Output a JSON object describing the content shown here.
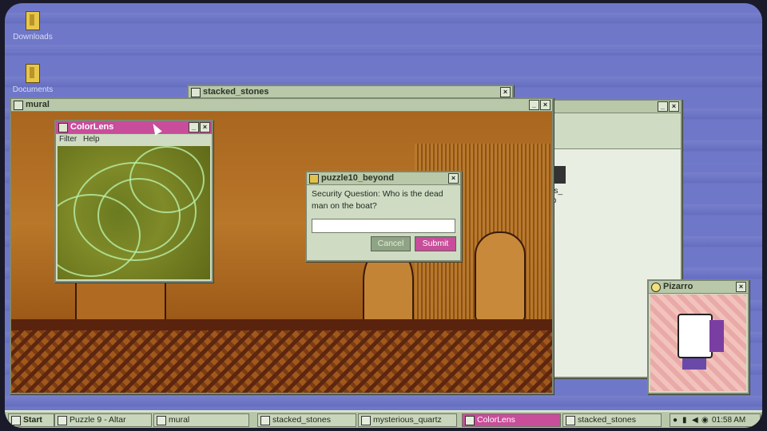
{
  "desktop": {
    "icons": [
      {
        "label": "Downloads",
        "icon": "folder-icon"
      },
      {
        "label": "Documents",
        "icon": "folder-icon"
      }
    ]
  },
  "windows": {
    "stacked_stones": {
      "title": "stacked_stones"
    },
    "back_window": {
      "partial_text": [
        "us_",
        "tp"
      ]
    },
    "mural": {
      "title": "mural"
    },
    "colorlens": {
      "title": "ColorLens",
      "menu": [
        "Filter",
        "Help"
      ]
    },
    "dialog": {
      "title": "puzzle10_beyond",
      "question": "Security Question: Who is the dead man on the boat?",
      "input_value": "",
      "cancel_label": "Cancel",
      "submit_label": "Submit"
    },
    "pizarro": {
      "title": "Pizarro"
    }
  },
  "taskbar": {
    "start_label": "Start",
    "items": [
      {
        "label": "Puzzle 9 - Altar",
        "active": false
      },
      {
        "label": "mural",
        "active": false
      },
      {
        "label": "stacked_stones",
        "active": false
      },
      {
        "label": "mysterious_quartz",
        "active": false
      },
      {
        "label": "ColorLens",
        "active": true
      },
      {
        "label": "stacked_stones",
        "active": false
      }
    ],
    "clock": "01:58 AM"
  },
  "colors": {
    "accent": "#c84d9a",
    "window_bg": "#cfdcc3",
    "desktop": "#6f78c8"
  }
}
